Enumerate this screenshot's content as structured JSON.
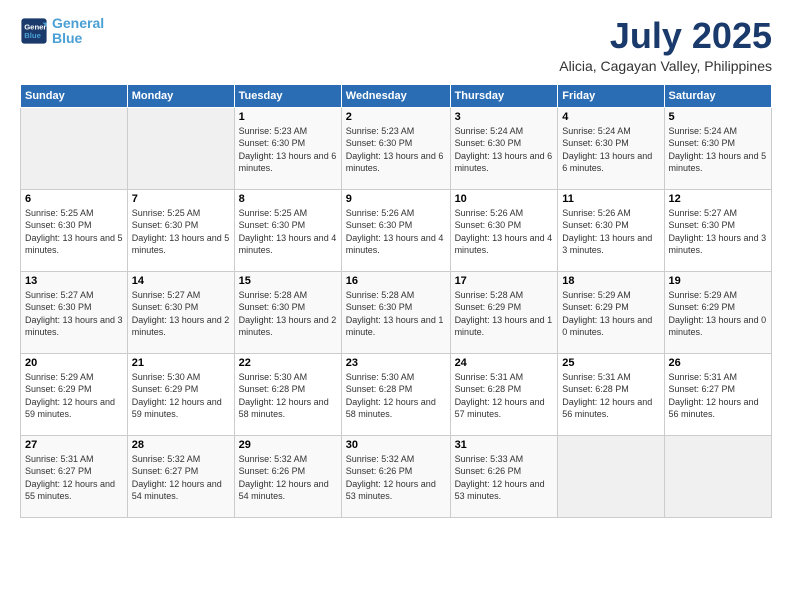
{
  "logo": {
    "line1": "General",
    "line2": "Blue"
  },
  "title": "July 2025",
  "subtitle": "Alicia, Cagayan Valley, Philippines",
  "days_of_week": [
    "Sunday",
    "Monday",
    "Tuesday",
    "Wednesday",
    "Thursday",
    "Friday",
    "Saturday"
  ],
  "weeks": [
    [
      {
        "day": "",
        "sunrise": "",
        "sunset": "",
        "daylight": ""
      },
      {
        "day": "",
        "sunrise": "",
        "sunset": "",
        "daylight": ""
      },
      {
        "day": "1",
        "sunrise": "Sunrise: 5:23 AM",
        "sunset": "Sunset: 6:30 PM",
        "daylight": "Daylight: 13 hours and 6 minutes."
      },
      {
        "day": "2",
        "sunrise": "Sunrise: 5:23 AM",
        "sunset": "Sunset: 6:30 PM",
        "daylight": "Daylight: 13 hours and 6 minutes."
      },
      {
        "day": "3",
        "sunrise": "Sunrise: 5:24 AM",
        "sunset": "Sunset: 6:30 PM",
        "daylight": "Daylight: 13 hours and 6 minutes."
      },
      {
        "day": "4",
        "sunrise": "Sunrise: 5:24 AM",
        "sunset": "Sunset: 6:30 PM",
        "daylight": "Daylight: 13 hours and 6 minutes."
      },
      {
        "day": "5",
        "sunrise": "Sunrise: 5:24 AM",
        "sunset": "Sunset: 6:30 PM",
        "daylight": "Daylight: 13 hours and 5 minutes."
      }
    ],
    [
      {
        "day": "6",
        "sunrise": "Sunrise: 5:25 AM",
        "sunset": "Sunset: 6:30 PM",
        "daylight": "Daylight: 13 hours and 5 minutes."
      },
      {
        "day": "7",
        "sunrise": "Sunrise: 5:25 AM",
        "sunset": "Sunset: 6:30 PM",
        "daylight": "Daylight: 13 hours and 5 minutes."
      },
      {
        "day": "8",
        "sunrise": "Sunrise: 5:25 AM",
        "sunset": "Sunset: 6:30 PM",
        "daylight": "Daylight: 13 hours and 4 minutes."
      },
      {
        "day": "9",
        "sunrise": "Sunrise: 5:26 AM",
        "sunset": "Sunset: 6:30 PM",
        "daylight": "Daylight: 13 hours and 4 minutes."
      },
      {
        "day": "10",
        "sunrise": "Sunrise: 5:26 AM",
        "sunset": "Sunset: 6:30 PM",
        "daylight": "Daylight: 13 hours and 4 minutes."
      },
      {
        "day": "11",
        "sunrise": "Sunrise: 5:26 AM",
        "sunset": "Sunset: 6:30 PM",
        "daylight": "Daylight: 13 hours and 3 minutes."
      },
      {
        "day": "12",
        "sunrise": "Sunrise: 5:27 AM",
        "sunset": "Sunset: 6:30 PM",
        "daylight": "Daylight: 13 hours and 3 minutes."
      }
    ],
    [
      {
        "day": "13",
        "sunrise": "Sunrise: 5:27 AM",
        "sunset": "Sunset: 6:30 PM",
        "daylight": "Daylight: 13 hours and 3 minutes."
      },
      {
        "day": "14",
        "sunrise": "Sunrise: 5:27 AM",
        "sunset": "Sunset: 6:30 PM",
        "daylight": "Daylight: 13 hours and 2 minutes."
      },
      {
        "day": "15",
        "sunrise": "Sunrise: 5:28 AM",
        "sunset": "Sunset: 6:30 PM",
        "daylight": "Daylight: 13 hours and 2 minutes."
      },
      {
        "day": "16",
        "sunrise": "Sunrise: 5:28 AM",
        "sunset": "Sunset: 6:30 PM",
        "daylight": "Daylight: 13 hours and 1 minute."
      },
      {
        "day": "17",
        "sunrise": "Sunrise: 5:28 AM",
        "sunset": "Sunset: 6:29 PM",
        "daylight": "Daylight: 13 hours and 1 minute."
      },
      {
        "day": "18",
        "sunrise": "Sunrise: 5:29 AM",
        "sunset": "Sunset: 6:29 PM",
        "daylight": "Daylight: 13 hours and 0 minutes."
      },
      {
        "day": "19",
        "sunrise": "Sunrise: 5:29 AM",
        "sunset": "Sunset: 6:29 PM",
        "daylight": "Daylight: 13 hours and 0 minutes."
      }
    ],
    [
      {
        "day": "20",
        "sunrise": "Sunrise: 5:29 AM",
        "sunset": "Sunset: 6:29 PM",
        "daylight": "Daylight: 12 hours and 59 minutes."
      },
      {
        "day": "21",
        "sunrise": "Sunrise: 5:30 AM",
        "sunset": "Sunset: 6:29 PM",
        "daylight": "Daylight: 12 hours and 59 minutes."
      },
      {
        "day": "22",
        "sunrise": "Sunrise: 5:30 AM",
        "sunset": "Sunset: 6:28 PM",
        "daylight": "Daylight: 12 hours and 58 minutes."
      },
      {
        "day": "23",
        "sunrise": "Sunrise: 5:30 AM",
        "sunset": "Sunset: 6:28 PM",
        "daylight": "Daylight: 12 hours and 58 minutes."
      },
      {
        "day": "24",
        "sunrise": "Sunrise: 5:31 AM",
        "sunset": "Sunset: 6:28 PM",
        "daylight": "Daylight: 12 hours and 57 minutes."
      },
      {
        "day": "25",
        "sunrise": "Sunrise: 5:31 AM",
        "sunset": "Sunset: 6:28 PM",
        "daylight": "Daylight: 12 hours and 56 minutes."
      },
      {
        "day": "26",
        "sunrise": "Sunrise: 5:31 AM",
        "sunset": "Sunset: 6:27 PM",
        "daylight": "Daylight: 12 hours and 56 minutes."
      }
    ],
    [
      {
        "day": "27",
        "sunrise": "Sunrise: 5:31 AM",
        "sunset": "Sunset: 6:27 PM",
        "daylight": "Daylight: 12 hours and 55 minutes."
      },
      {
        "day": "28",
        "sunrise": "Sunrise: 5:32 AM",
        "sunset": "Sunset: 6:27 PM",
        "daylight": "Daylight: 12 hours and 54 minutes."
      },
      {
        "day": "29",
        "sunrise": "Sunrise: 5:32 AM",
        "sunset": "Sunset: 6:26 PM",
        "daylight": "Daylight: 12 hours and 54 minutes."
      },
      {
        "day": "30",
        "sunrise": "Sunrise: 5:32 AM",
        "sunset": "Sunset: 6:26 PM",
        "daylight": "Daylight: 12 hours and 53 minutes."
      },
      {
        "day": "31",
        "sunrise": "Sunrise: 5:33 AM",
        "sunset": "Sunset: 6:26 PM",
        "daylight": "Daylight: 12 hours and 53 minutes."
      },
      {
        "day": "",
        "sunrise": "",
        "sunset": "",
        "daylight": ""
      },
      {
        "day": "",
        "sunrise": "",
        "sunset": "",
        "daylight": ""
      }
    ]
  ]
}
